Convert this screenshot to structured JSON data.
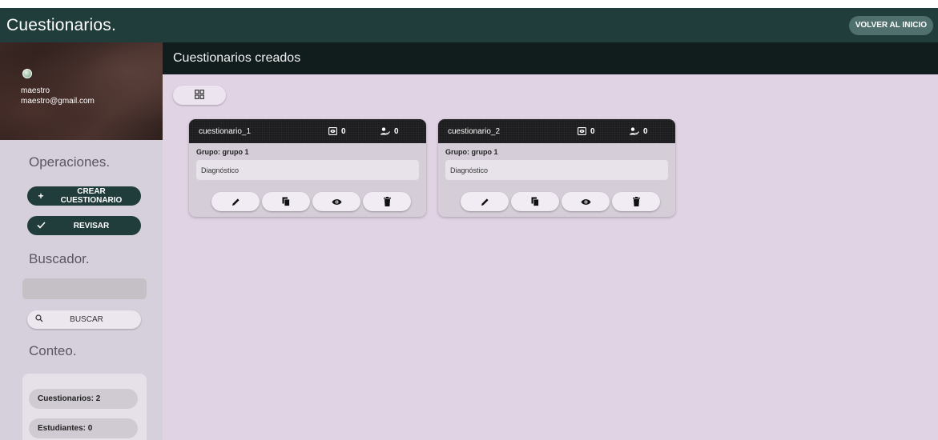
{
  "app": {
    "title": "Cuestionarios.",
    "home_button": "VOLVER AL INICIO"
  },
  "profile": {
    "name": "maestro",
    "email": "maestro@gmail.com"
  },
  "sidebar": {
    "operations_title": "Operaciones.",
    "create_button": "CREAR CUESTIONARIO",
    "review_button": "REVISAR",
    "search_title": "Buscador.",
    "search_placeholder": "",
    "search_button": "BUSCAR",
    "count_title": "Conteo.",
    "count_quizzes": "Cuestionarios: 2",
    "count_students": "Estudiantes: 0"
  },
  "main": {
    "header": "Cuestionarios creados",
    "cards": [
      {
        "name": "cuestionario_1",
        "views": "0",
        "students": "0",
        "group": "Grupo: grupo 1",
        "description": "Diagnóstico"
      },
      {
        "name": "cuestionario_2",
        "views": "0",
        "students": "0",
        "group": "Grupo: grupo 1",
        "description": "Diagnóstico"
      }
    ]
  },
  "colors": {
    "topbar": "#203c3b",
    "main_bg": "#e0d3e3",
    "sidebar_bg": "#d6d0dc",
    "header_bg": "#111d1d"
  }
}
